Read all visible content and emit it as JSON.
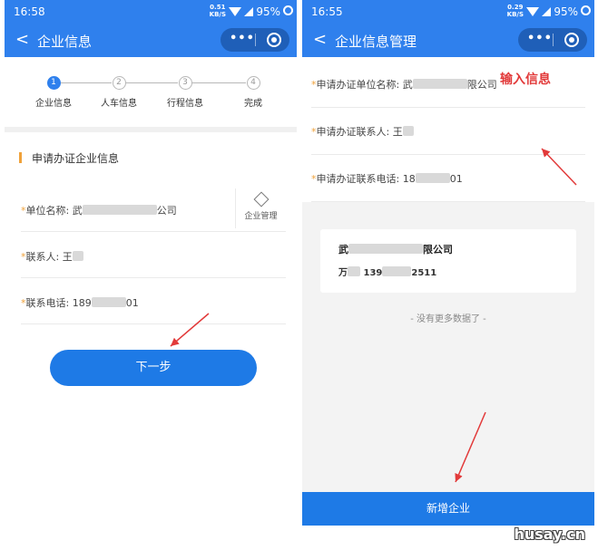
{
  "left": {
    "status": {
      "time": "16:58",
      "net_top": "0.51",
      "net_bottom": "KB/S",
      "battery": "95%"
    },
    "nav": {
      "back": "<",
      "title": "企业信息",
      "more": "•••"
    },
    "steps": [
      {
        "num": "1",
        "label": "企业信息"
      },
      {
        "num": "2",
        "label": "人车信息"
      },
      {
        "num": "3",
        "label": "行程信息"
      },
      {
        "num": "4",
        "label": "完成"
      }
    ],
    "section_title": "申请办证企业信息",
    "fields": {
      "company_label": "单位名称: ",
      "company_prefix": "武",
      "company_suffix": "公司",
      "contact_label": "联系人: ",
      "contact_value": "王",
      "phone_label": "联系电话: ",
      "phone_prefix": "189",
      "phone_suffix": "01",
      "required_mark": "*"
    },
    "manage_label": "企业管理",
    "next_label": "下一步"
  },
  "right": {
    "status": {
      "time": "16:55",
      "net_top": "0.29",
      "net_bottom": "KB/S",
      "battery": "95%"
    },
    "nav": {
      "back": "<",
      "title": "企业信息管理",
      "more": "•••"
    },
    "fields": {
      "company_label": "申请办证单位名称: ",
      "company_prefix": "武",
      "company_suffix": "限公司",
      "contact_label": "申请办证联系人: ",
      "contact_value": "王",
      "phone_label": "申请办证联系电话: ",
      "phone_prefix": "18",
      "phone_suffix": "01",
      "required_mark": "*"
    },
    "hint": "输入信息",
    "card": {
      "name_prefix": "武",
      "name_suffix": "限公司",
      "person_prefix": "万",
      "phone_prefix": "139",
      "phone_suffix": "2511"
    },
    "no_more": "- 没有更多数据了 -",
    "add_label": "新增企业"
  },
  "watermark": "husay.cn",
  "colors": {
    "primary": "#2f80ed",
    "button": "#1e7ae6",
    "accent": "#f0a23a",
    "annotation": "#e23a3a"
  }
}
